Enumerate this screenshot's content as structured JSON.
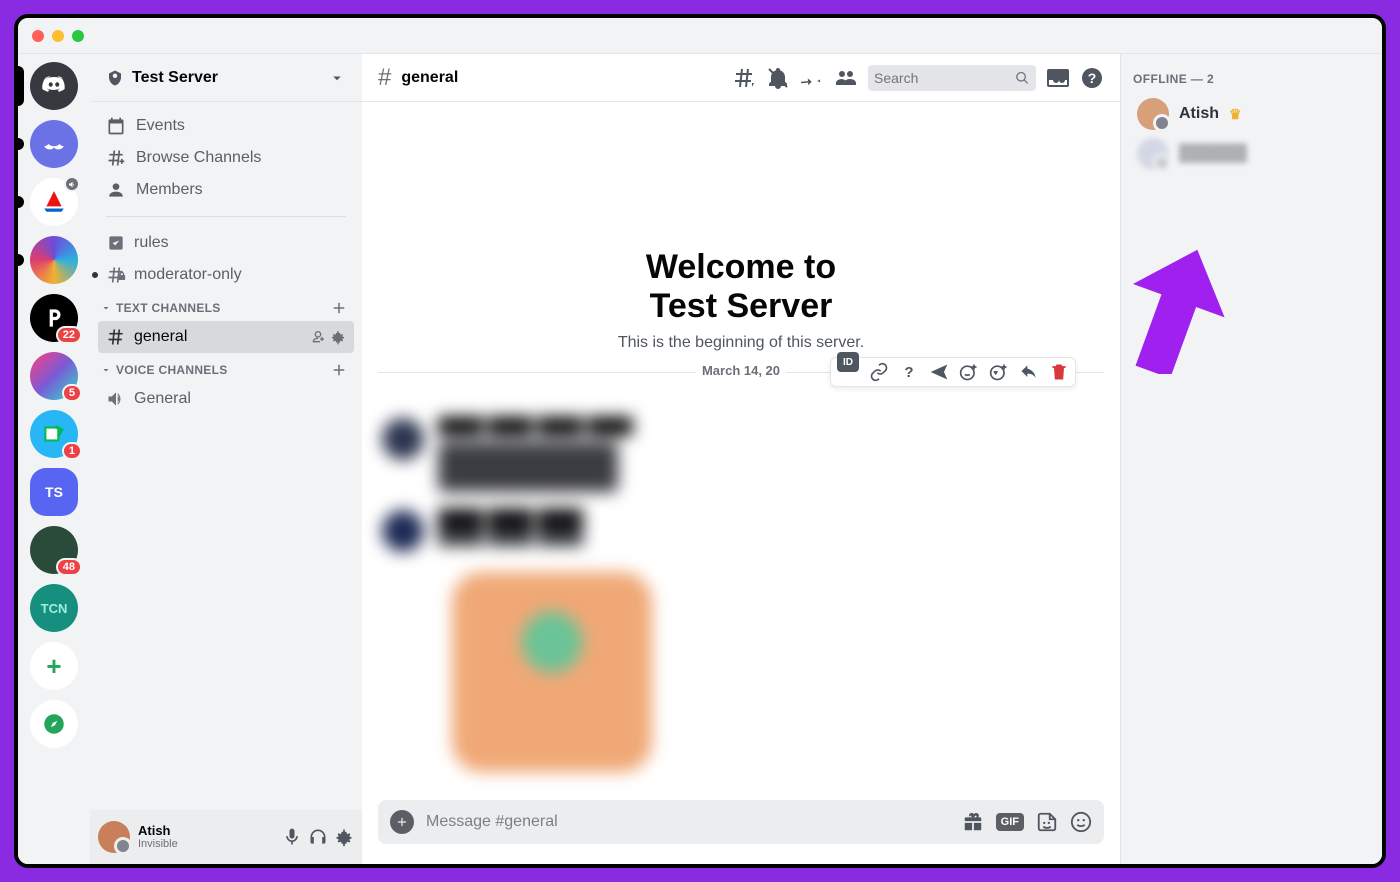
{
  "server": {
    "name": "Test Server"
  },
  "rail": {
    "badges": {
      "i3": "22",
      "i5": "5",
      "i6": "1",
      "i8": "48"
    },
    "labels": {
      "ts": "TS",
      "tcn": "TCN"
    }
  },
  "sidebar": {
    "events": "Events",
    "browse": "Browse Channels",
    "members": "Members",
    "rules": "rules",
    "mod": "moderator-only",
    "cat_text": "TEXT CHANNELS",
    "cat_voice": "VOICE CHANNELS",
    "general": "general",
    "voice_general": "General"
  },
  "user": {
    "name": "Atish",
    "status": "Invisible"
  },
  "header": {
    "channel": "general",
    "search_placeholder": "Search"
  },
  "welcome": {
    "line1": "Welcome to",
    "line2": "Test Server",
    "sub": "This is the beginning of this server.",
    "date": "March 14, 20"
  },
  "input": {
    "placeholder": "Message #general"
  },
  "msg_actions": {
    "id": "ID"
  },
  "members": {
    "heading": "OFFLINE — 2",
    "m1": "Atish"
  }
}
